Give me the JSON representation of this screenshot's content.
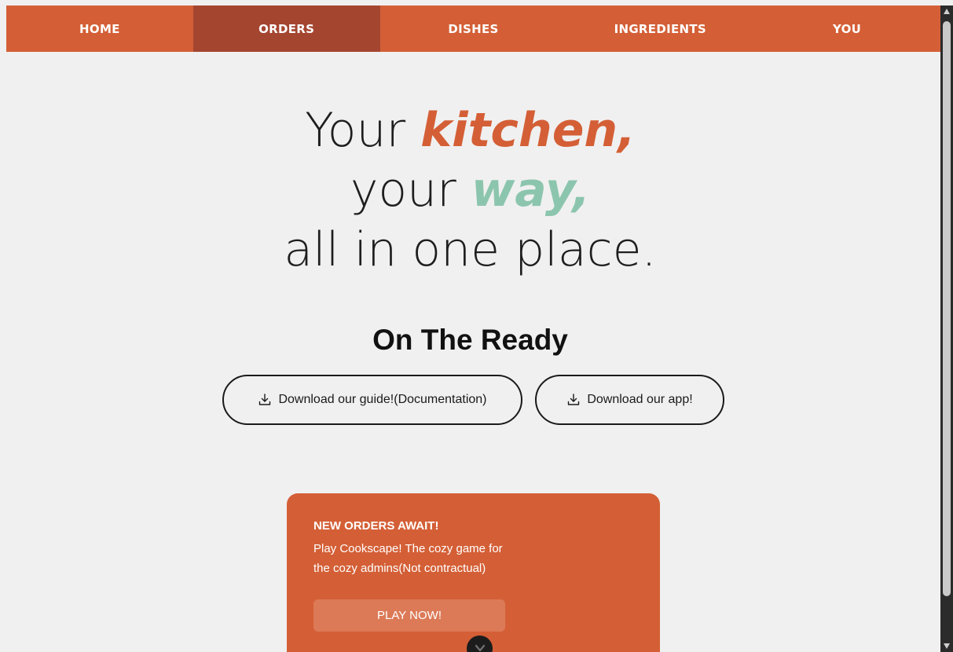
{
  "nav": {
    "items": [
      {
        "label": "HOME",
        "active": false
      },
      {
        "label": "ORDERS",
        "active": true
      },
      {
        "label": "DISHES",
        "active": false
      },
      {
        "label": "INGREDIENTS",
        "active": false
      },
      {
        "label": "YOU",
        "active": false
      }
    ]
  },
  "hero": {
    "line1_prefix": "Your ",
    "line1_highlight": "kitchen,",
    "line2_prefix": "your ",
    "line2_highlight": "way,",
    "line3": "all in one place."
  },
  "section": {
    "title": "On The Ready"
  },
  "downloads": {
    "guide_label": "Download our guide!(Documentation)",
    "app_label": "Download our app!",
    "icon": "download-icon"
  },
  "promo": {
    "title": "NEW ORDERS AWAIT!",
    "text": "Play Cookscape! The cozy game for the cozy admins(Not contractual)",
    "button_label": "PLAY NOW!",
    "toggle_icon": "chevron-down-icon"
  },
  "colors": {
    "brand": "#d45f36",
    "nav_active": "#a44530",
    "accent_green": "#8cc5ae",
    "background": "#f0f0f0"
  }
}
